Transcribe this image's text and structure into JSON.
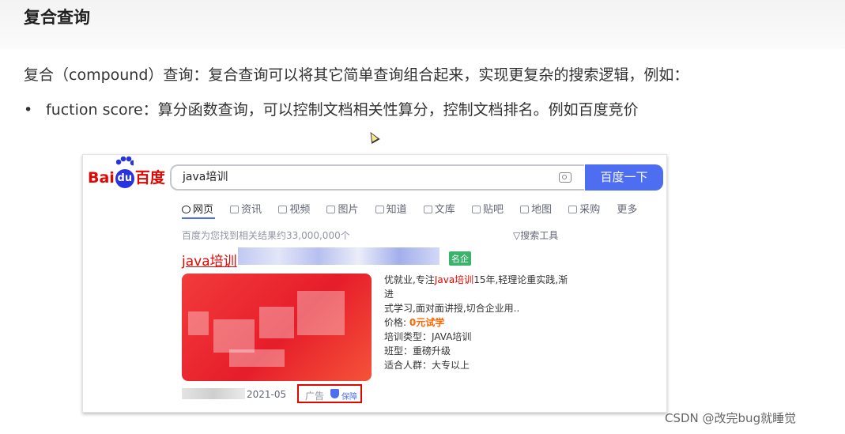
{
  "section": {
    "title": "复合查询",
    "intro": "复合（compound）查询：复合查询可以将其它简单查询组合起来，实现更复杂的搜索逻辑，例如：",
    "bullet_symbol": "•",
    "bullet_text": "fuction score：算分函数查询，可以控制文档相关性算分，控制文档排名。例如百度竞价"
  },
  "screenshot": {
    "logo": {
      "left": "Bai",
      "badge": "du",
      "right": "百度"
    },
    "search_value": "java培训",
    "search_button": "百度一下",
    "tabs": [
      "网页",
      "资讯",
      "视频",
      "图片",
      "知道",
      "文库",
      "贴吧",
      "地图",
      "采购",
      "更多"
    ],
    "active_tab": "网页",
    "stats": "百度为您找到相关结果约33,000,000个",
    "tools": "搜索工具",
    "ad": {
      "title": "java培训",
      "badge": "名企",
      "desc_line1_pre": "优就业,专注",
      "desc_line1_hl": "Java培训",
      "desc_line1_post": "15年,轻理论重实践,渐进",
      "desc_line2": "式学习,面对面讲授,切合企业用..",
      "price_label": "价格:",
      "price_value": "0元试学",
      "type": "培训类型：JAVA培训",
      "class": "班型：重磅升级",
      "audience": "适合人群：大专以上",
      "date": "2021-05",
      "ad_label": "广告",
      "guarantee": "保障"
    }
  },
  "watermark": "CSDN @改完bug就睡觉",
  "colors": {
    "baidu_red": "#e10601",
    "baidu_blue": "#4e6ef2",
    "badge_green": "#3bb36b"
  }
}
